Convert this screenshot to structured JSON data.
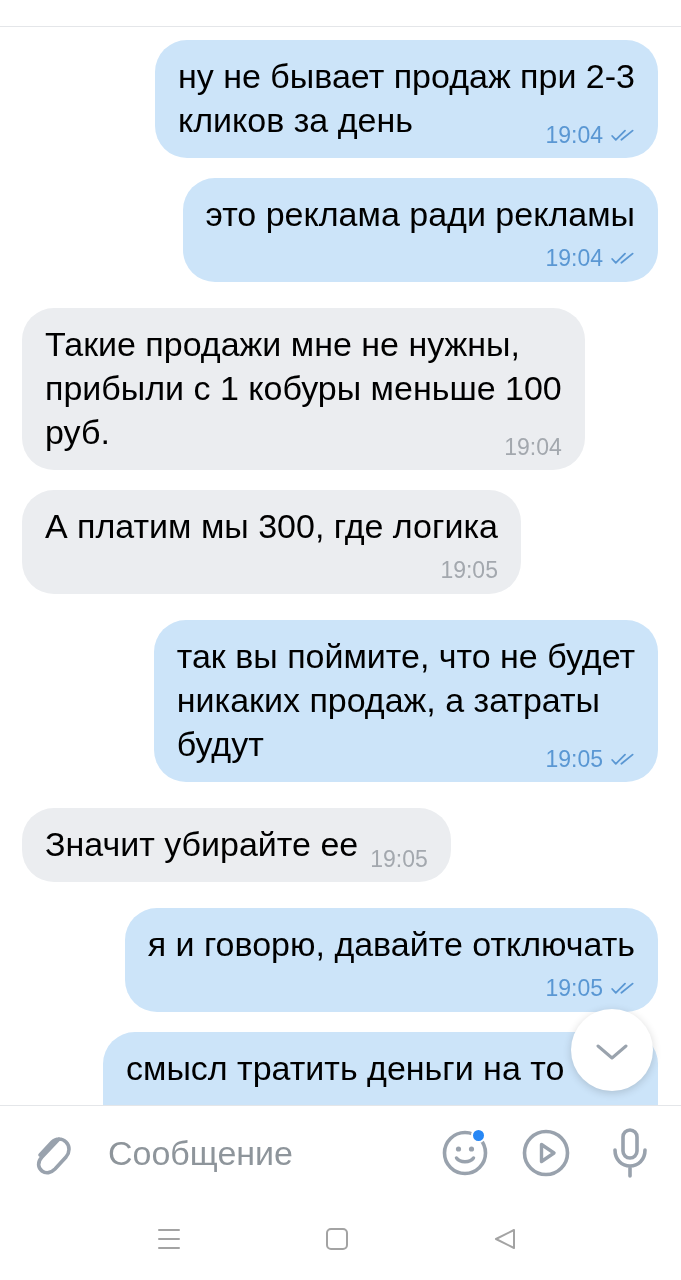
{
  "messages": [
    {
      "kind": "outgoing",
      "lines": [
        "ну не бывает продаж при 2-3",
        "кликов за день"
      ],
      "time": "19:04",
      "read": true
    },
    {
      "kind": "outgoing",
      "lines": [
        "это реклама ради рекламы"
      ],
      "time": "19:04",
      "read": true
    },
    {
      "kind": "incoming",
      "lines": [
        "Такие продажи мне не нужны,",
        "прибыли с 1 кобуры меньше 100",
        "руб."
      ],
      "time": "19:04"
    },
    {
      "kind": "incoming",
      "lines": [
        "А платим мы 300, где логика"
      ],
      "time": "19:05"
    },
    {
      "kind": "outgoing",
      "lines": [
        "так вы поймите, что не будет",
        "никаких продаж, а затраты",
        "будут"
      ],
      "time": "19:05",
      "read": true
    },
    {
      "kind": "incoming",
      "lines": [
        "Значит убирайте ее"
      ],
      "time": "19:05"
    },
    {
      "kind": "outgoing",
      "lines": [
        "я и говорю, давайте отключать"
      ],
      "time": "19:05",
      "read": true
    },
    {
      "kind": "outgoing",
      "lines": [
        "смысл тратить деньги на то"
      ]
    }
  ],
  "composer": {
    "placeholder": "Сообщение",
    "emoji_badge": true
  }
}
